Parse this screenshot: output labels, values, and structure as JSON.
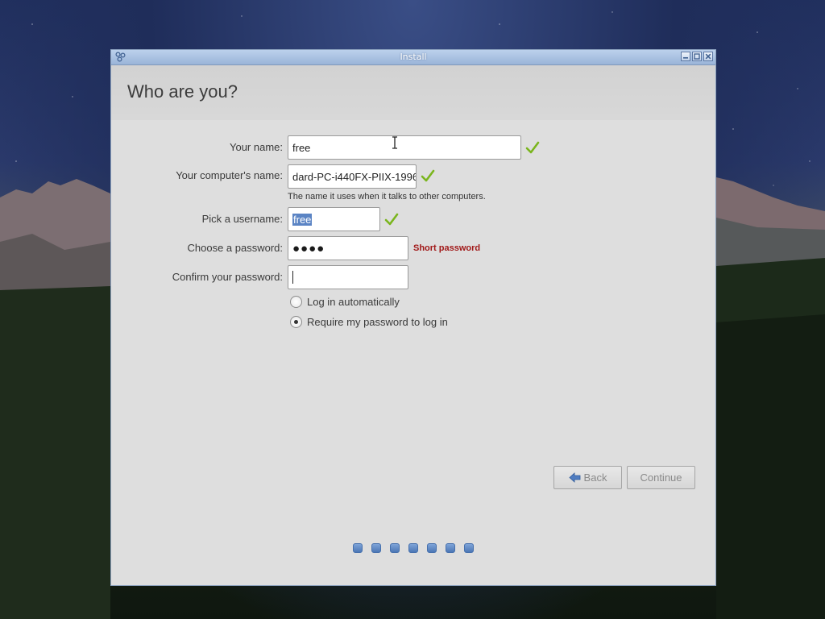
{
  "window": {
    "title": "Install"
  },
  "page": {
    "title": "Who are you?"
  },
  "form": {
    "name_label": "Your name:",
    "name_value": "free",
    "computer_label": "Your computer's name:",
    "computer_value": "dard-PC-i440FX-PIIX-1996",
    "computer_hint": "The name it uses when it talks to other computers.",
    "username_label": "Pick a username:",
    "username_value": "free",
    "password_label": "Choose a password:",
    "password_value": "●●●●",
    "password_warning": "Short password",
    "confirm_label": "Confirm your password:",
    "confirm_value": ""
  },
  "login": {
    "auto_label": "Log in automatically",
    "auto_selected": false,
    "require_label": "Require my password to log in",
    "require_selected": true
  },
  "buttons": {
    "back": "Back",
    "continue": "Continue"
  },
  "progress": {
    "total": 7
  },
  "colors": {
    "check_green": "#7ab51d",
    "warning_red": "#a11919",
    "selection_blue": "#5b84c4",
    "titlebar_blue": "#9ab4d8"
  }
}
